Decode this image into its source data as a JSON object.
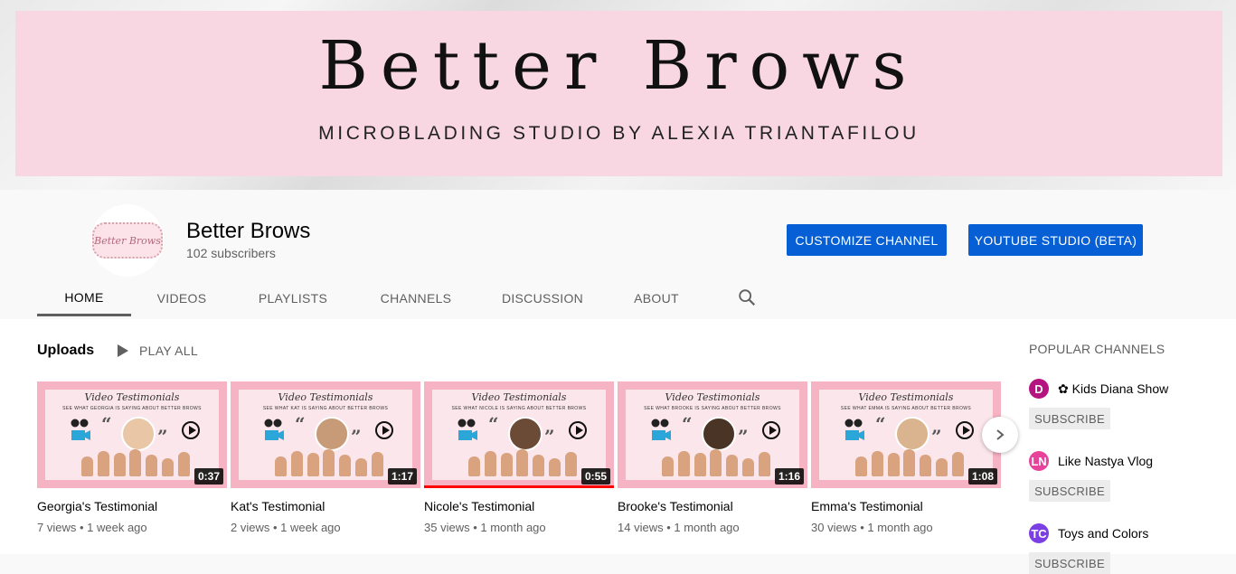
{
  "banner": {
    "title": "Better Brows",
    "subtitle": "MICROBLADING STUDIO BY ALEXIA TRIANTAFILOU"
  },
  "channel": {
    "name": "Better Brows",
    "subscribers": "102 subscribers",
    "avatar_text": "Better Brows",
    "customize_label": "CUSTOMIZE CHANNEL",
    "studio_label": "YOUTUBE STUDIO (BETA)"
  },
  "tabs": [
    {
      "label": "HOME",
      "active": true
    },
    {
      "label": "VIDEOS"
    },
    {
      "label": "PLAYLISTS"
    },
    {
      "label": "CHANNELS"
    },
    {
      "label": "DISCUSSION"
    },
    {
      "label": "ABOUT"
    }
  ],
  "uploads": {
    "title": "Uploads",
    "play_all": "PLAY ALL"
  },
  "thumbnail_text": {
    "title": "Video Testimonials"
  },
  "videos": [
    {
      "title": "Georgia's Testimonial",
      "views": "7 views",
      "age": "1 week ago",
      "duration": "0:37",
      "thumb_sub": "SEE WHAT GEORGIA IS SAYING ABOUT BETTER BROWS",
      "watched_fraction": 0
    },
    {
      "title": "Kat's Testimonial",
      "views": "2 views",
      "age": "1 week ago",
      "duration": "1:17",
      "thumb_sub": "SEE WHAT KAT IS SAYING ABOUT BETTER BROWS",
      "watched_fraction": 0
    },
    {
      "title": "Nicole's Testimonial",
      "views": "35 views",
      "age": "1 month ago",
      "duration": "0:55",
      "thumb_sub": "SEE WHAT NICOLE IS SAYING ABOUT BETTER BROWS",
      "watched_fraction": 1
    },
    {
      "title": "Brooke's Testimonial",
      "views": "14 views",
      "age": "1 month ago",
      "duration": "1:16",
      "thumb_sub": "SEE WHAT BROOKE IS SAYING ABOUT BETTER BROWS",
      "watched_fraction": 0
    },
    {
      "title": "Emma's Testimonial",
      "views": "30 views",
      "age": "1 month ago",
      "duration": "1:08",
      "thumb_sub": "SEE WHAT EMMA IS SAYING ABOUT BETTER BROWS",
      "watched_fraction": 0
    }
  ],
  "popular": {
    "title": "POPULAR CHANNELS",
    "subscribe_label": "SUBSCRIBE",
    "channels": [
      {
        "name": "✿ Kids Diana Show",
        "logo_text": "D",
        "color": "#b5137f"
      },
      {
        "name": "Like Nastya Vlog",
        "logo_text": "LN",
        "color": "#e8439a"
      },
      {
        "name": "Toys and Colors",
        "logo_text": "TC",
        "color": "#7b3fe4"
      }
    ]
  },
  "colors": {
    "accent": "#065fd4",
    "banner_pink": "#f8d7e2",
    "progress_red": "#ff0000"
  },
  "icons": {
    "search": "search-icon",
    "play_all": "play-icon",
    "next": "chevron-right-icon"
  }
}
